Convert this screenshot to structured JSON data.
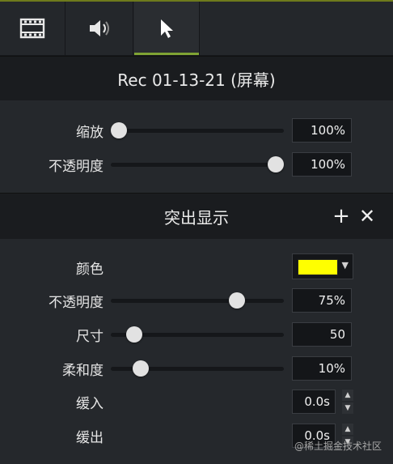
{
  "tabs": [
    {
      "icon": "film-icon"
    },
    {
      "icon": "speaker-icon"
    },
    {
      "icon": "cursor-icon",
      "active": true
    }
  ],
  "clip": {
    "title": "Rec 01-13-21 (屏幕)",
    "scale": {
      "label": "缩放",
      "value": "100%",
      "level": 0.0
    },
    "opacity": {
      "label": "不透明度",
      "value": "100%",
      "level": 1.0
    }
  },
  "highlight": {
    "title": "突出显示",
    "add_icon": "plus-icon",
    "remove_icon": "close-icon",
    "color": {
      "label": "颜色",
      "swatch": "#ffff00"
    },
    "opacity": {
      "label": "不透明度",
      "value": "75%",
      "level": 0.75
    },
    "size": {
      "label": "尺寸",
      "value": "50",
      "level": 0.1
    },
    "softness": {
      "label": "柔和度",
      "value": "10%",
      "level": 0.14
    },
    "ease_in": {
      "label": "缓入",
      "value": "0.0s"
    },
    "ease_out": {
      "label": "缓出",
      "value": "0.0s"
    }
  },
  "watermark": "@稀土掘金技术社区"
}
